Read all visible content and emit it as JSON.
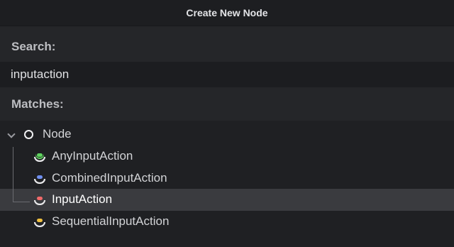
{
  "dialog": {
    "title": "Create New Node"
  },
  "search": {
    "label": "Search:",
    "value": "inputaction"
  },
  "matches": {
    "label": "Matches:",
    "root": {
      "label": "Node",
      "icon": "circle-node-icon",
      "expanded": true
    },
    "items": [
      {
        "label": "AnyInputAction",
        "icon": "input-action-icon",
        "color": "#5fd35f",
        "selected": false
      },
      {
        "label": "CombinedInputAction",
        "icon": "input-action-icon",
        "color": "#6f8ff0",
        "selected": false
      },
      {
        "label": "InputAction",
        "icon": "input-action-icon",
        "color": "#f06a6a",
        "selected": true
      },
      {
        "label": "SequentialInputAction",
        "icon": "input-action-icon",
        "color": "#f0c040",
        "selected": false
      }
    ]
  }
}
